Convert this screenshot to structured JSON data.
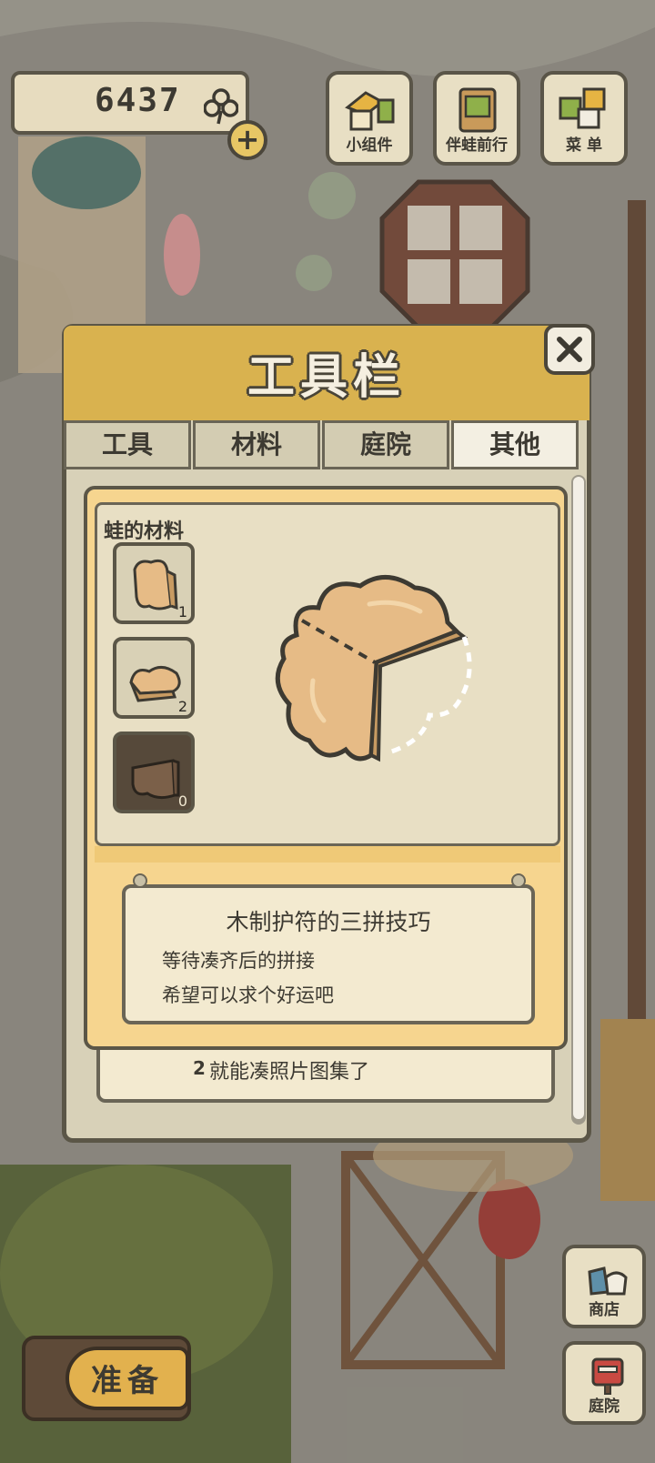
{
  "hud": {
    "clover_count": "6437",
    "plus_label": "+",
    "buttons": [
      {
        "label": "小组件",
        "icon": "widget-icon"
      },
      {
        "label": "伴蛙前行",
        "icon": "travel-book-icon"
      },
      {
        "label": "菜 单",
        "icon": "menu-cards-icon"
      }
    ]
  },
  "modal": {
    "title": "工具栏",
    "close_label": "✕",
    "tabs": [
      {
        "label": "工具",
        "active": false
      },
      {
        "label": "材料",
        "active": false
      },
      {
        "label": "庭院",
        "active": false
      },
      {
        "label": "其他",
        "active": true
      }
    ],
    "behind_card": {
      "count": "2",
      "text": "就能凑照片图集了"
    },
    "detail": {
      "category": "蛙的材料",
      "pieces": [
        {
          "count": "1",
          "owned": true
        },
        {
          "count": "2",
          "owned": true
        },
        {
          "count": "0",
          "owned": false
        }
      ],
      "title": "木制护符的三拼技巧",
      "lines": [
        "等待凑齐后的拼接",
        "希望可以求个好运吧"
      ]
    }
  },
  "bottom": {
    "ready_label": "准备",
    "shop_label": "商店",
    "yard_label": "庭院"
  },
  "colors": {
    "panel_gold": "#d9b24f",
    "panel_bg": "#d8d1b8",
    "detail_bg": "#f6d58f",
    "outline": "#5b5647"
  }
}
